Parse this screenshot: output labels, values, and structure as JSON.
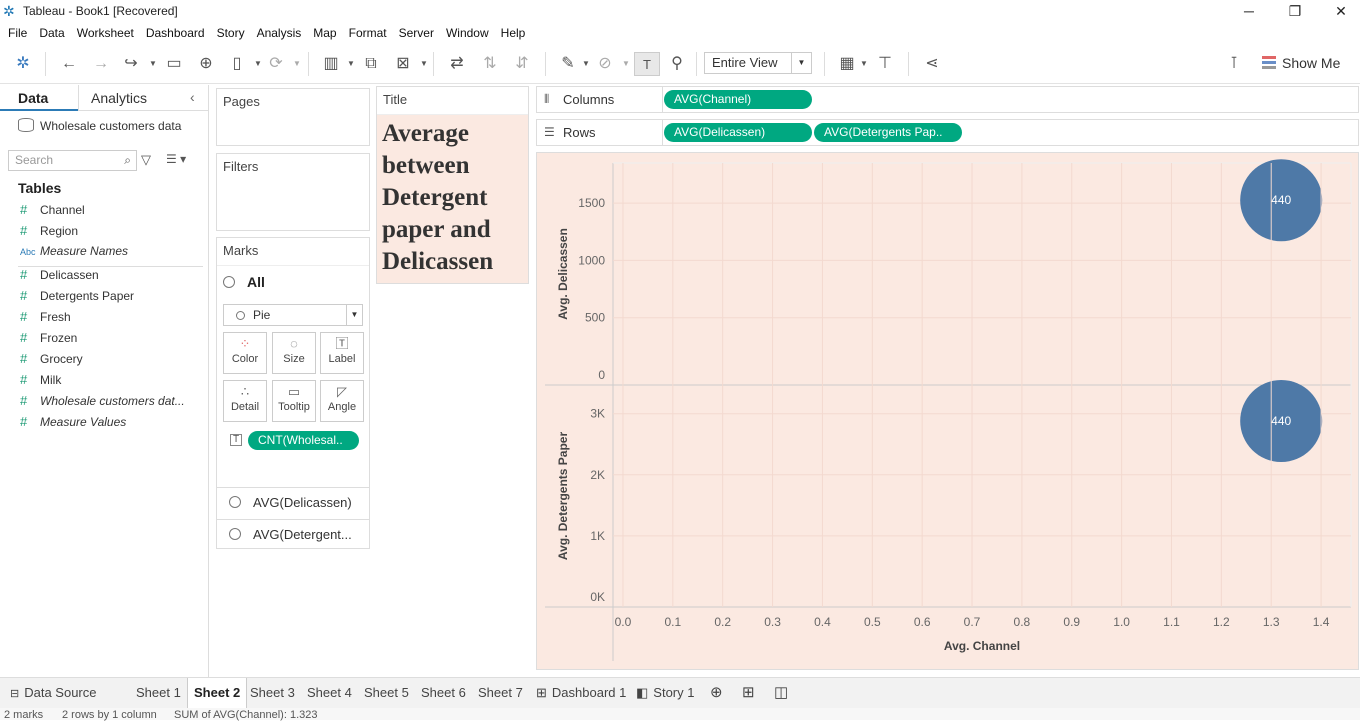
{
  "window": {
    "title": "Tableau - Book1 [Recovered]"
  },
  "menu": [
    "File",
    "Data",
    "Worksheet",
    "Dashboard",
    "Story",
    "Analysis",
    "Map",
    "Format",
    "Server",
    "Window",
    "Help"
  ],
  "toolbar": {
    "fit_mode": "Entire View",
    "show_me": "Show Me"
  },
  "data_pane": {
    "tab_data": "Data",
    "tab_analytics": "Analytics",
    "datasource": "Wholesale customers data",
    "search_placeholder": "Search",
    "tables_header": "Tables",
    "dimensions": [
      {
        "name": "Channel",
        "type": "#"
      },
      {
        "name": "Region",
        "type": "#"
      },
      {
        "name": "Measure Names",
        "type": "Abc"
      }
    ],
    "measures": [
      {
        "name": "Delicassen",
        "type": "#"
      },
      {
        "name": "Detergents Paper",
        "type": "#"
      },
      {
        "name": "Fresh",
        "type": "#"
      },
      {
        "name": "Frozen",
        "type": "#"
      },
      {
        "name": "Grocery",
        "type": "#"
      },
      {
        "name": "Milk",
        "type": "#"
      },
      {
        "name": "Wholesale customers dat...",
        "type": "#"
      },
      {
        "name": "Measure Values",
        "type": "#"
      }
    ]
  },
  "cards": {
    "pages": "Pages",
    "filters": "Filters",
    "marks": "Marks",
    "marks_all": "All",
    "mark_type": "Pie",
    "buttons": [
      "Color",
      "Size",
      "Label",
      "Detail",
      "Tooltip",
      "Angle"
    ],
    "label_pill": "CNT(Wholesal..",
    "mark_rows": [
      "AVG(Delicassen)",
      "AVG(Detergent..."
    ],
    "title_header": "Title",
    "title_text": "Average between Detergent paper and Delicassen"
  },
  "shelves": {
    "columns_label": "Columns",
    "rows_label": "Rows",
    "columns_pills": [
      "AVG(Channel)"
    ],
    "rows_pills": [
      "AVG(Delicassen)",
      "AVG(Detergents Pap.."
    ]
  },
  "chart_data": [
    {
      "type": "scatter",
      "ylabel": "Avg. Delicassen",
      "yticks": [
        "0",
        "500",
        "1000",
        "1500"
      ],
      "ylim": [
        0,
        1850
      ],
      "xlim": [
        -0.02,
        1.46
      ],
      "points": [
        {
          "x": 1.32,
          "y": 1525,
          "label": "440"
        }
      ]
    },
    {
      "type": "scatter",
      "ylabel": "Avg. Detergents Paper",
      "yticks": [
        "0K",
        "1K",
        "2K",
        "3K"
      ],
      "ylim": [
        0,
        3470
      ],
      "xlim": [
        -0.02,
        1.46
      ],
      "xlabel": "Avg. Channel",
      "xticks": [
        "0.0",
        "0.1",
        "0.2",
        "0.3",
        "0.4",
        "0.5",
        "0.6",
        "0.7",
        "0.8",
        "0.9",
        "1.0",
        "1.1",
        "1.2",
        "1.3",
        "1.4"
      ],
      "points": [
        {
          "x": 1.32,
          "y": 2881,
          "label": "440"
        }
      ]
    }
  ],
  "colors": {
    "mark": "#4e79a7",
    "pill": "#00a881",
    "viz_bg": "#fbe9e1"
  },
  "sheet_tabs": {
    "data_source": "Data Source",
    "sheets": [
      "Sheet 1",
      "Sheet 2",
      "Sheet 3",
      "Sheet 4",
      "Sheet 5",
      "Sheet 6",
      "Sheet 7"
    ],
    "active": "Sheet 2",
    "dashboard": "Dashboard 1",
    "story": "Story 1"
  },
  "status": {
    "marks": "2 marks",
    "rowscols": "2 rows by 1 column",
    "sum": "SUM of AVG(Channel): 1.323"
  }
}
